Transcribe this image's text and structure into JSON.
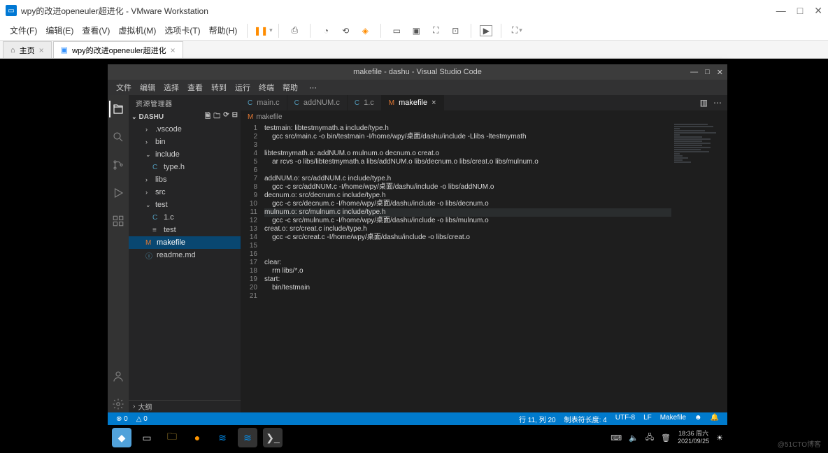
{
  "vmware": {
    "title": "wpy的改进openeuler超进化 - VMware Workstation",
    "menus": [
      "文件(F)",
      "编辑(E)",
      "查看(V)",
      "虚拟机(M)",
      "选项卡(T)",
      "帮助(H)"
    ],
    "tabs": {
      "home": "主页",
      "vm": "wpy的改进openeuler超进化"
    }
  },
  "vscode": {
    "title": "makefile - dashu - Visual Studio Code",
    "menus": [
      "文件",
      "编辑",
      "选择",
      "查看",
      "转到",
      "运行",
      "终端",
      "帮助"
    ],
    "sidebar": {
      "title": "资源管理器",
      "project": "DASHU",
      "outline": "大纲",
      "items": {
        "vscode": ".vscode",
        "bin": "bin",
        "include": "include",
        "typeh": "type.h",
        "libs": "libs",
        "src": "src",
        "test": "test",
        "onec": "1.c",
        "testf": "test",
        "makefile": "makefile",
        "readme": "readme.md"
      }
    },
    "tabs": {
      "main": "main.c",
      "add": "addNUM.c",
      "one": "1.c",
      "mk": "makefile"
    },
    "breadcrumb": "makefile",
    "code": [
      "testmain: libtestmymath.a include/type.h",
      "    gcc src/main.c -o bin/testmain -I/home/wpy/桌面/dashu/include -Llibs -ltestmymath",
      "",
      "libtestmymath.a: addNUM.o mulnum.o decnum.o creat.o",
      "    ar rcvs -o libs/libtestmymath.a libs/addNUM.o libs/decnum.o libs/creat.o libs/mulnum.o",
      "",
      "addNUM.o: src/addNUM.c include/type.h",
      "    gcc -c src/addNUM.c -I/home/wpy/桌面/dashu/include -o libs/addNUM.o",
      "decnum.o: src/decnum.c include/type.h",
      "    gcc -c src/decnum.c -I/home/wpy/桌面/dashu/include -o libs/decnum.o",
      "mulnum.o: src/mulnum.c include/type.h",
      "    gcc -c src/mulnum.c -I/home/wpy/桌面/dashu/include -o libs/mulnum.o",
      "creat.o: src/creat.c include/type.h",
      "    gcc -c src/creat.c -I/home/wpy/桌面/dashu/include -o libs/creat.o",
      "",
      "",
      "clear:",
      "    rm libs/*.o",
      "start:",
      "    bin/testmain",
      ""
    ],
    "status": {
      "errors": "⊗ 0",
      "warnings": "△ 0",
      "pos": "行 11, 列 20",
      "tab": "制表符长度: 4",
      "enc": "UTF-8",
      "eol": "LF",
      "lang": "Makefile"
    }
  },
  "taskbar": {
    "time": "18:36 周六",
    "date": "2021/09/25"
  },
  "watermark": "@51CTO博客"
}
